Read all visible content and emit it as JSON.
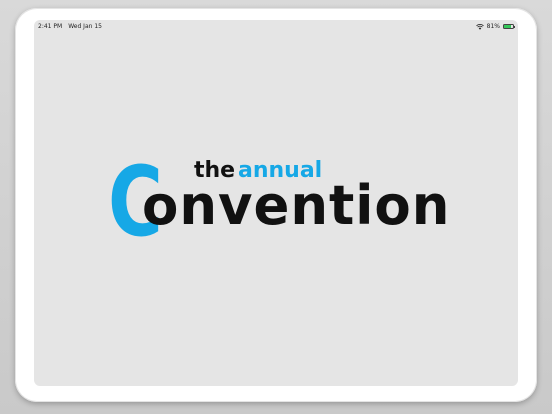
{
  "status_bar": {
    "time": "2:41 PM",
    "date": "Wed Jan 15",
    "battery_percent": "81%",
    "battery_level": 0.81,
    "wifi_icon": "wifi-icon",
    "battery_icon": "battery-icon"
  },
  "logo": {
    "c_letter": "C",
    "the": "the",
    "annual": "annual",
    "rest": "onvention",
    "accent_color": "#16a8e6",
    "text_color": "#111111"
  }
}
